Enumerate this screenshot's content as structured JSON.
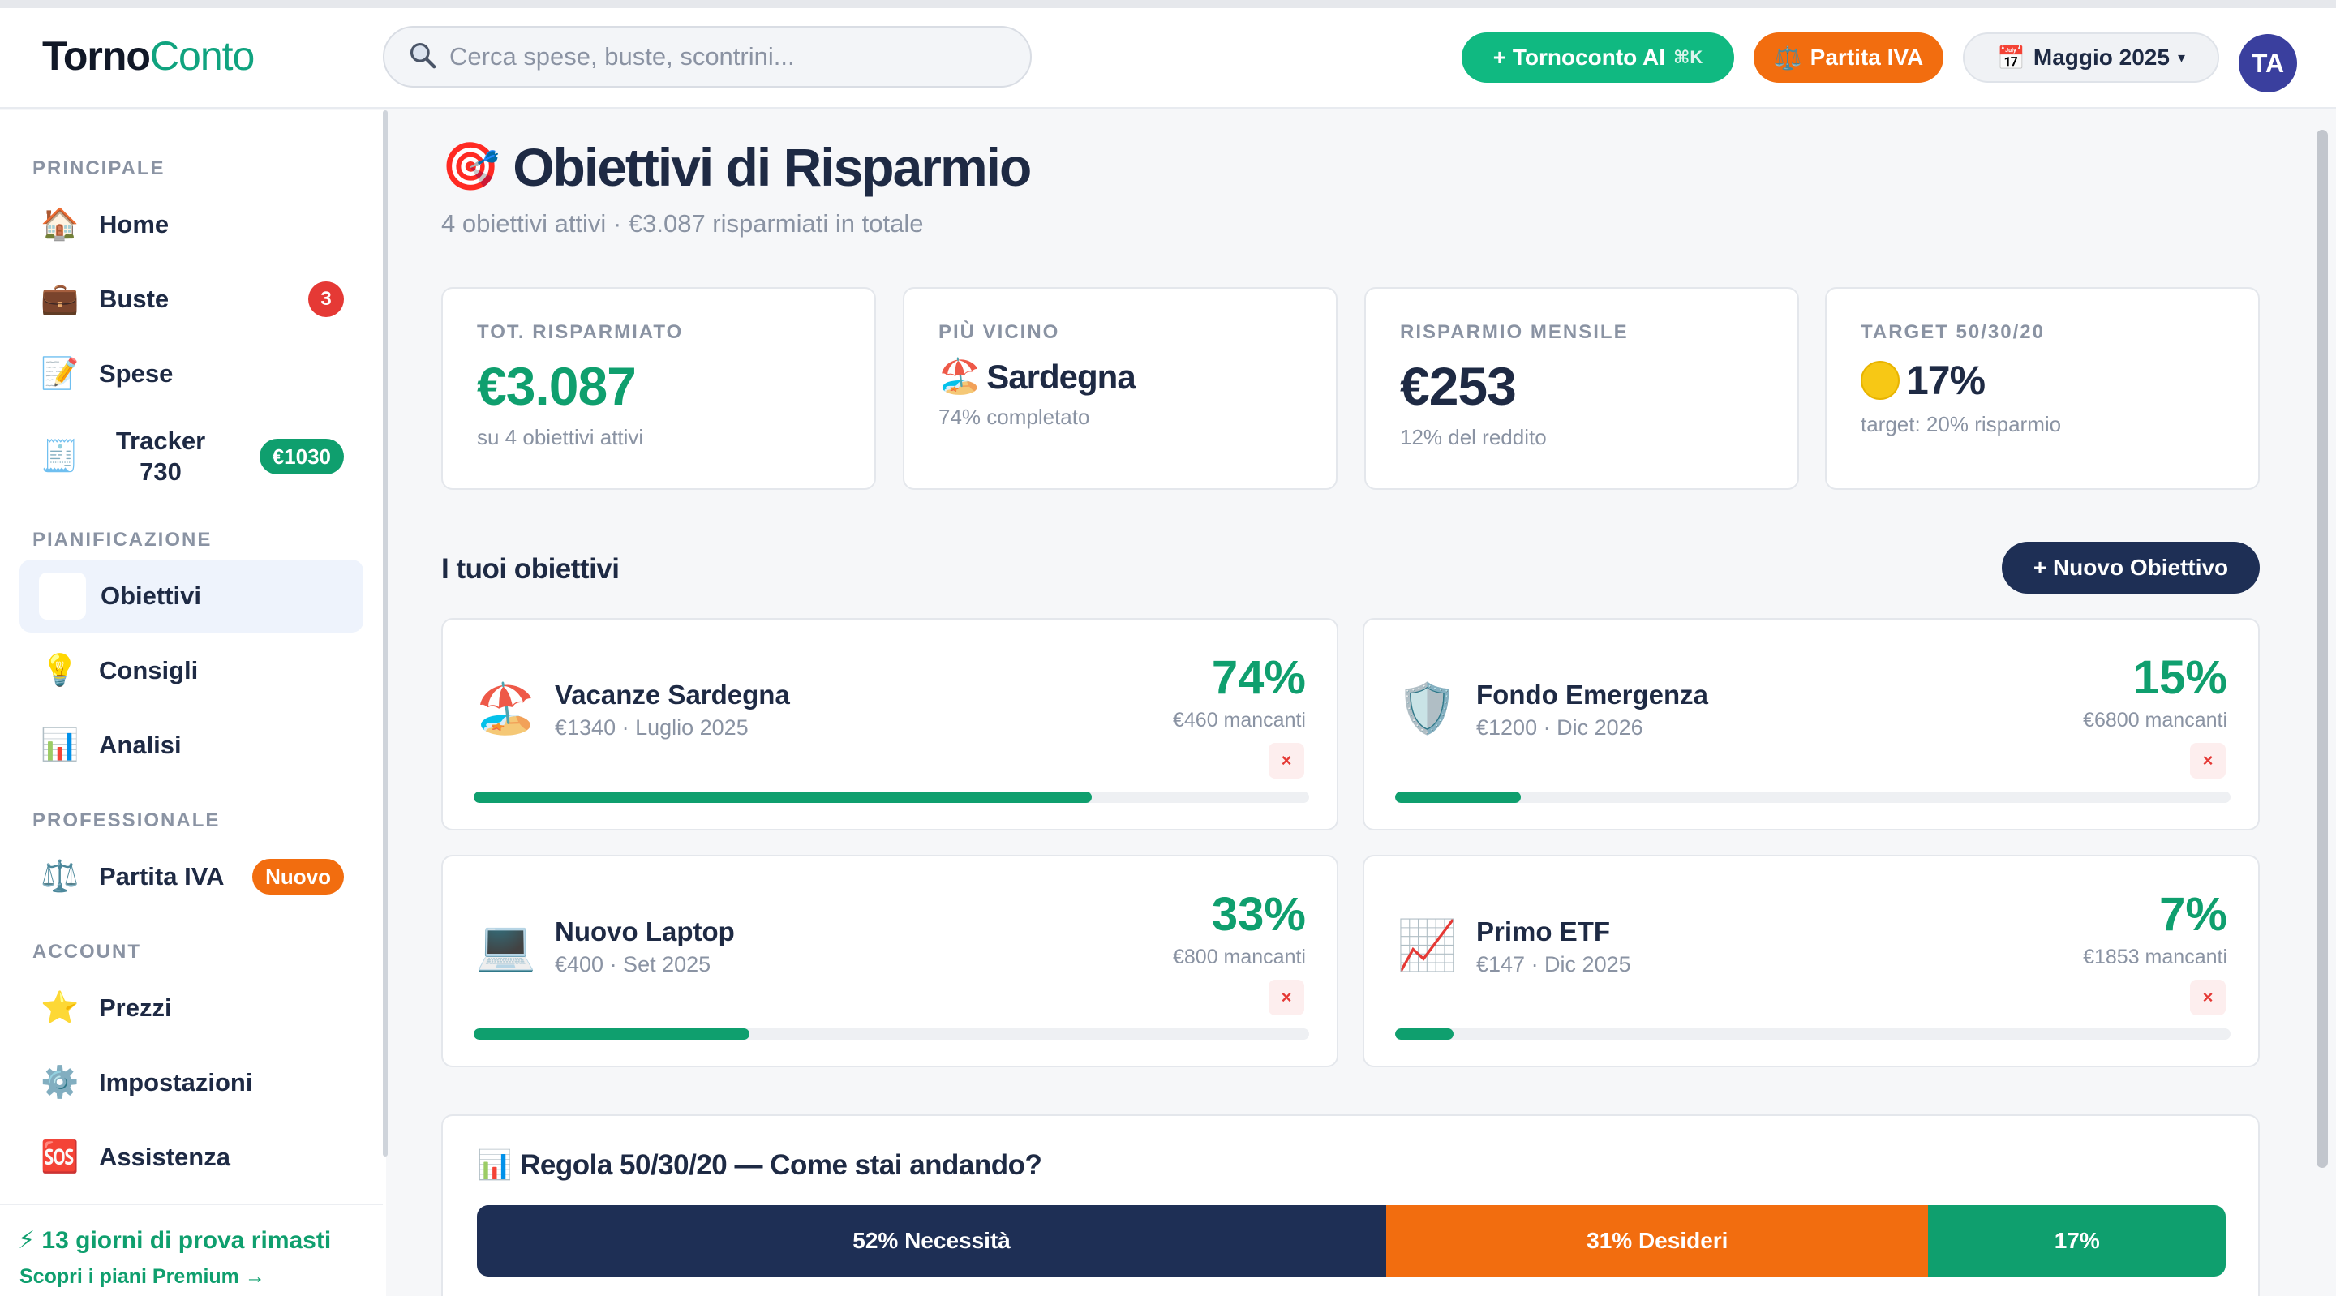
{
  "header": {
    "logo_part1": "Torno",
    "logo_part2": "Conto",
    "search_placeholder": "Cerca spese, buste, scontrini...",
    "ai_button": "+ Tornoconto AI",
    "ai_shortcut": "⌘K",
    "iva_button": "Partita IVA",
    "month": "Maggio 2025",
    "avatar_initials": "TA"
  },
  "sidebar": {
    "sections": {
      "principale": "PRINCIPALE",
      "pianificazione": "PIANIFICAZIONE",
      "professionale": "PROFESSIONALE",
      "account": "ACCOUNT"
    },
    "items": [
      {
        "label": "Home",
        "icon": "house-icon"
      },
      {
        "label": "Buste",
        "icon": "briefcase-icon",
        "badge": "3"
      },
      {
        "label": "Spese",
        "icon": "memo-icon"
      },
      {
        "label": "Tracker 730",
        "icon": "receipt-icon",
        "badge": "€1030"
      },
      {
        "label": "Obiettivi",
        "icon": "target-icon"
      },
      {
        "label": "Consigli",
        "icon": "lightbulb-icon"
      },
      {
        "label": "Analisi",
        "icon": "bar-chart-icon"
      },
      {
        "label": "Partita IVA",
        "icon": "scales-icon",
        "badge": "Nuovo"
      },
      {
        "label": "Prezzi",
        "icon": "star-icon"
      },
      {
        "label": "Impostazioni",
        "icon": "gear-icon"
      },
      {
        "label": "Assistenza",
        "icon": "sos-icon"
      }
    ],
    "trial_text": "13 giorni di prova rimasti",
    "trial_link": "Scopri i piani Premium →"
  },
  "page": {
    "title": "Obiettivi di Risparmio",
    "subtitle": "4 obiettivi attivi · €3.087 risparmiati in totale"
  },
  "stats": [
    {
      "label": "TOT. RISPARMIATO",
      "value": "€3.087",
      "sub": "su 4 obiettivi attivi"
    },
    {
      "label": "PIÙ VICINO",
      "value": "Sardegna",
      "sub": "74% completato"
    },
    {
      "label": "RISPARMIO MENSILE",
      "value": "€253",
      "sub": "12% del reddito"
    },
    {
      "label": "TARGET 50/30/20",
      "value": "17%",
      "sub": "target: 20% risparmio"
    }
  ],
  "goals_section": {
    "title": "I tuoi obiettivi",
    "new_button": "+ Nuovo Obiettivo"
  },
  "goals": [
    {
      "name": "Vacanze Sardegna",
      "meta": "€1340 · Luglio 2025",
      "pct_label": "74%",
      "missing": "€460 mancanti",
      "progress": 0.74,
      "icon": "beach-umbrella-icon"
    },
    {
      "name": "Fondo Emergenza",
      "meta": "€1200 · Dic 2026",
      "pct_label": "15%",
      "missing": "€6800 mancanti",
      "progress": 0.15,
      "icon": "shield-icon"
    },
    {
      "name": "Nuovo Laptop",
      "meta": "€400 · Set 2025",
      "pct_label": "33%",
      "missing": "€800 mancanti",
      "progress": 0.33,
      "icon": "laptop-icon"
    },
    {
      "name": "Primo ETF",
      "meta": "€147 · Dic 2025",
      "pct_label": "7%",
      "missing": "€1853 mancanti",
      "progress": 0.07,
      "icon": "chart-up-icon"
    }
  ],
  "delete_label": "×",
  "rule": {
    "title": "Regola 50/30/20 — Come stai andando?",
    "segments": [
      {
        "label": "52% Necessità",
        "share": 0.52,
        "color": "#1e2f55"
      },
      {
        "label": "31% Desideri",
        "share": 0.31,
        "color": "#f26d0f"
      },
      {
        "label": "17%",
        "share": 0.17,
        "color": "#0f9f6e"
      }
    ]
  },
  "colors": {
    "accent": "#0f9f6e",
    "orange": "#f26d0f",
    "navy": "#1e2f55"
  }
}
